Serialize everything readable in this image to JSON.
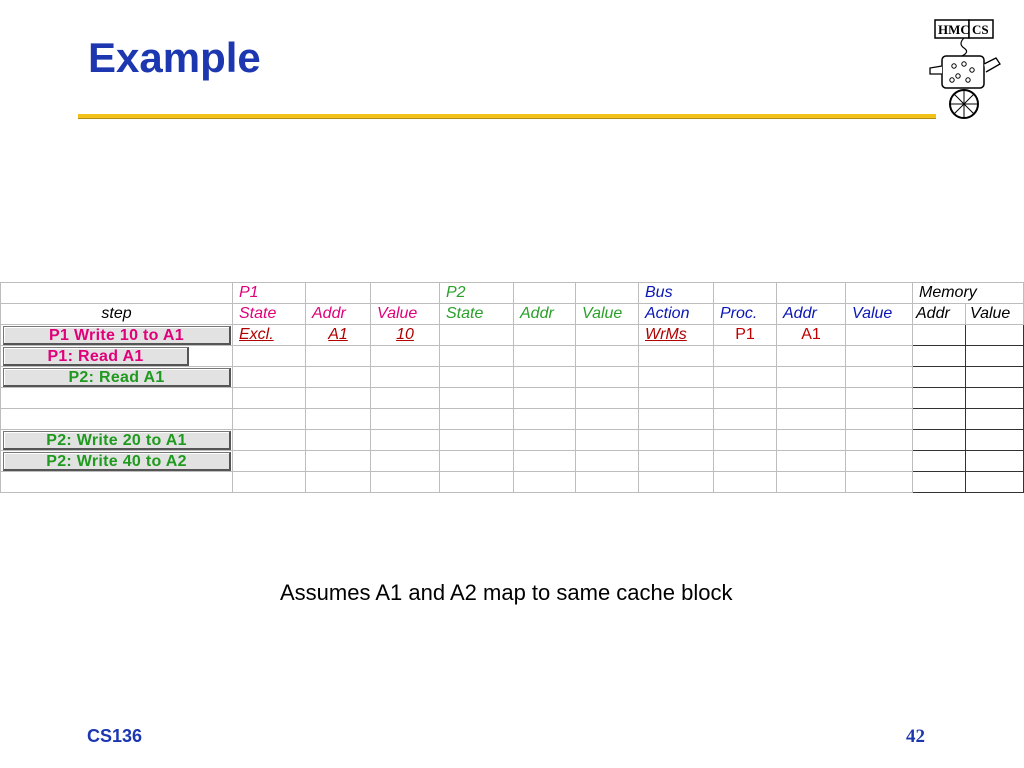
{
  "slide": {
    "title": "Example",
    "note": "Assumes A1 and A2 map to same cache block",
    "footer_left": "CS136",
    "page_number": "42",
    "logo_text": "HMC CS"
  },
  "table": {
    "group_row": {
      "p1": "P1",
      "p2": "P2",
      "bus": "Bus",
      "memory": "Memory"
    },
    "header_row": {
      "step": "step",
      "p1_state": "State",
      "p1_addr": "Addr",
      "p1_value": "Value",
      "p2_state": "State",
      "p2_addr": "Addr",
      "p2_value": "Value",
      "bus_action": "Action",
      "bus_proc": "Proc.",
      "bus_addr": "Addr",
      "bus_value": "Value",
      "mem_addr": "Addr",
      "mem_value": "Value"
    },
    "steps": [
      "P1 Write 10 to A1",
      "P1: Read A1",
      "P2: Read A1",
      "",
      "",
      "P2: Write 20 to A1",
      "P2: Write 40 to A2",
      ""
    ],
    "row1": {
      "p1_state": "Excl.",
      "p1_addr": "A1",
      "p1_value": "10",
      "bus_action": "WrMs",
      "bus_proc": "P1",
      "bus_addr": "A1"
    }
  },
  "colors": {
    "title_blue": "#1c37b0",
    "rule_gold": "#f3c21a",
    "p1_magenta": "#e0007a",
    "p2_green": "#2aa02a",
    "bus_blue": "#0a16b5",
    "entry_red": "#c00000"
  }
}
